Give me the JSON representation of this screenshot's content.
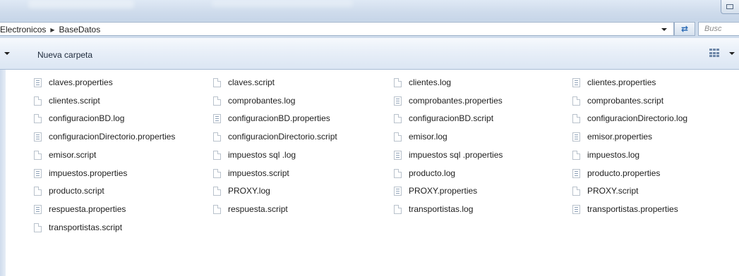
{
  "address": {
    "crumbs": [
      "Electronicos",
      "BaseDatos"
    ],
    "search_placeholder": "Busc"
  },
  "toolbar": {
    "new_folder": "Nueva carpeta"
  },
  "files": [
    [
      "claves.properties",
      "claves.script",
      "clientes.log",
      "clientes.properties"
    ],
    [
      "clientes.script",
      "comprobantes.log",
      "comprobantes.properties",
      "comprobantes.script"
    ],
    [
      "configuracionBD.log",
      "configuracionBD.properties",
      "configuracionBD.script",
      "configuracionDirectorio.log"
    ],
    [
      "configuracionDirectorio.properties",
      "configuracionDirectorio.script",
      "emisor.log",
      "emisor.properties"
    ],
    [
      "emisor.script",
      "impuestos sql .log",
      "impuestos sql .properties",
      "impuestos.log"
    ],
    [
      "impuestos.properties",
      "impuestos.script",
      "producto.log",
      "producto.properties"
    ],
    [
      "producto.script",
      "PROXY.log",
      "PROXY.properties",
      "PROXY.script"
    ],
    [
      "respuesta.properties",
      "respuesta.script",
      "transportistas.log",
      "transportistas.properties"
    ],
    [
      "transportistas.script"
    ]
  ],
  "icons": {
    "properties": "settings-file-icon",
    "other": "blank-file-icon"
  },
  "colors": {
    "frame": "#cfdcec",
    "toolbar": "#e8eff8",
    "text": "#1e1e1e"
  }
}
